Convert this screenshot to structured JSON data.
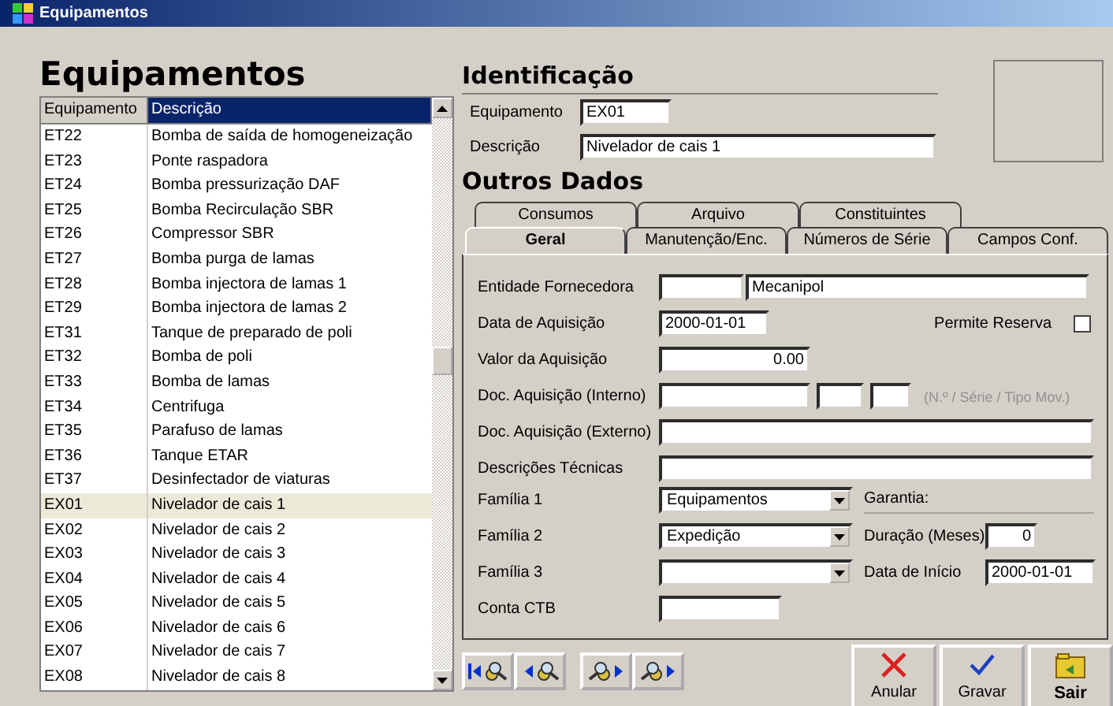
{
  "window": {
    "title": "Equipamentos"
  },
  "list": {
    "heading": "Equipamentos",
    "columns": [
      {
        "label": "Equipamento",
        "active": false
      },
      {
        "label": "Descrição",
        "active": true
      }
    ],
    "rows": [
      {
        "code": "ET22",
        "description": "Bomba de saída de homogeneização",
        "selected": false
      },
      {
        "code": "ET23",
        "description": "Ponte raspadora",
        "selected": false
      },
      {
        "code": "ET24",
        "description": "Bomba pressurização DAF",
        "selected": false
      },
      {
        "code": "ET25",
        "description": "Bomba Recirculação SBR",
        "selected": false
      },
      {
        "code": "ET26",
        "description": "Compressor SBR",
        "selected": false
      },
      {
        "code": "ET27",
        "description": "Bomba purga de lamas",
        "selected": false
      },
      {
        "code": "ET28",
        "description": "Bomba injectora de lamas 1",
        "selected": false
      },
      {
        "code": "ET29",
        "description": "Bomba injectora de lamas 2",
        "selected": false
      },
      {
        "code": "ET31",
        "description": "Tanque de preparado de poli",
        "selected": false
      },
      {
        "code": "ET32",
        "description": "Bomba de poli",
        "selected": false
      },
      {
        "code": "ET33",
        "description": "Bomba de lamas",
        "selected": false
      },
      {
        "code": "ET34",
        "description": "Centrifuga",
        "selected": false
      },
      {
        "code": "ET35",
        "description": "Parafuso de lamas",
        "selected": false
      },
      {
        "code": "ET36",
        "description": "Tanque ETAR",
        "selected": false
      },
      {
        "code": "ET37",
        "description": "Desinfectador de viaturas",
        "selected": false
      },
      {
        "code": "EX01",
        "description": "Nivelador de cais 1",
        "selected": true
      },
      {
        "code": "EX02",
        "description": "Nivelador de cais 2",
        "selected": false
      },
      {
        "code": "EX03",
        "description": "Nivelador de cais 3",
        "selected": false
      },
      {
        "code": "EX04",
        "description": "Nivelador de cais 4",
        "selected": false
      },
      {
        "code": "EX05",
        "description": "Nivelador de cais 5",
        "selected": false
      },
      {
        "code": "EX06",
        "description": "Nivelador de cais 6",
        "selected": false
      },
      {
        "code": "EX07",
        "description": "Nivelador de cais 7",
        "selected": false
      },
      {
        "code": "EX08",
        "description": "Nivelador de cais 8",
        "selected": false
      }
    ]
  },
  "identification": {
    "heading": "Identificação",
    "code_label": "Equipamento",
    "code_value": "EX01",
    "description_label": "Descrição",
    "description_value": "Nivelador de cais 1"
  },
  "other": {
    "heading": "Outros Dados",
    "tabs_back": [
      {
        "label": "Consumos",
        "selected": false
      },
      {
        "label": "Arquivo",
        "selected": false
      },
      {
        "label": "Constituintes",
        "selected": false
      }
    ],
    "tabs_front": [
      {
        "label": "Geral",
        "selected": true
      },
      {
        "label": "Manutenção/Enc.",
        "selected": false
      },
      {
        "label": "Números de Série",
        "selected": false
      },
      {
        "label": "Campos Conf.",
        "selected": false
      }
    ],
    "supplier_label": "Entidade Fornecedora",
    "supplier_name": "Mecanipol",
    "purchase_date_label": "Data de Aquisição",
    "purchase_date": "2000-01-01",
    "reserve_label": "Permite Reserva",
    "reserve_checked": false,
    "value_label": "Valor da Aquisição",
    "value": "0.00",
    "doc_internal_label": "Doc. Aquisição (Interno)",
    "doc_internal_hint": "(N.º / Série / Tipo Mov.)",
    "doc_external_label": "Doc. Aquisição (Externo)",
    "tech_label": "Descrições Técnicas",
    "family1_label": "Família 1",
    "family1": "Equipamentos",
    "family2_label": "Família 2",
    "family2": "Expedição",
    "family3_label": "Família 3",
    "account_label": "Conta CTB",
    "warranty_label": "Garantia:",
    "duration_label": "Duração (Meses)",
    "duration": "0",
    "start_label": "Data de Início",
    "start_date": "2000-01-01"
  },
  "actions": [
    {
      "kind": "cancel",
      "label": "Anular"
    },
    {
      "kind": "save",
      "label": "Gravar"
    },
    {
      "kind": "exit",
      "label": "Sair"
    }
  ]
}
